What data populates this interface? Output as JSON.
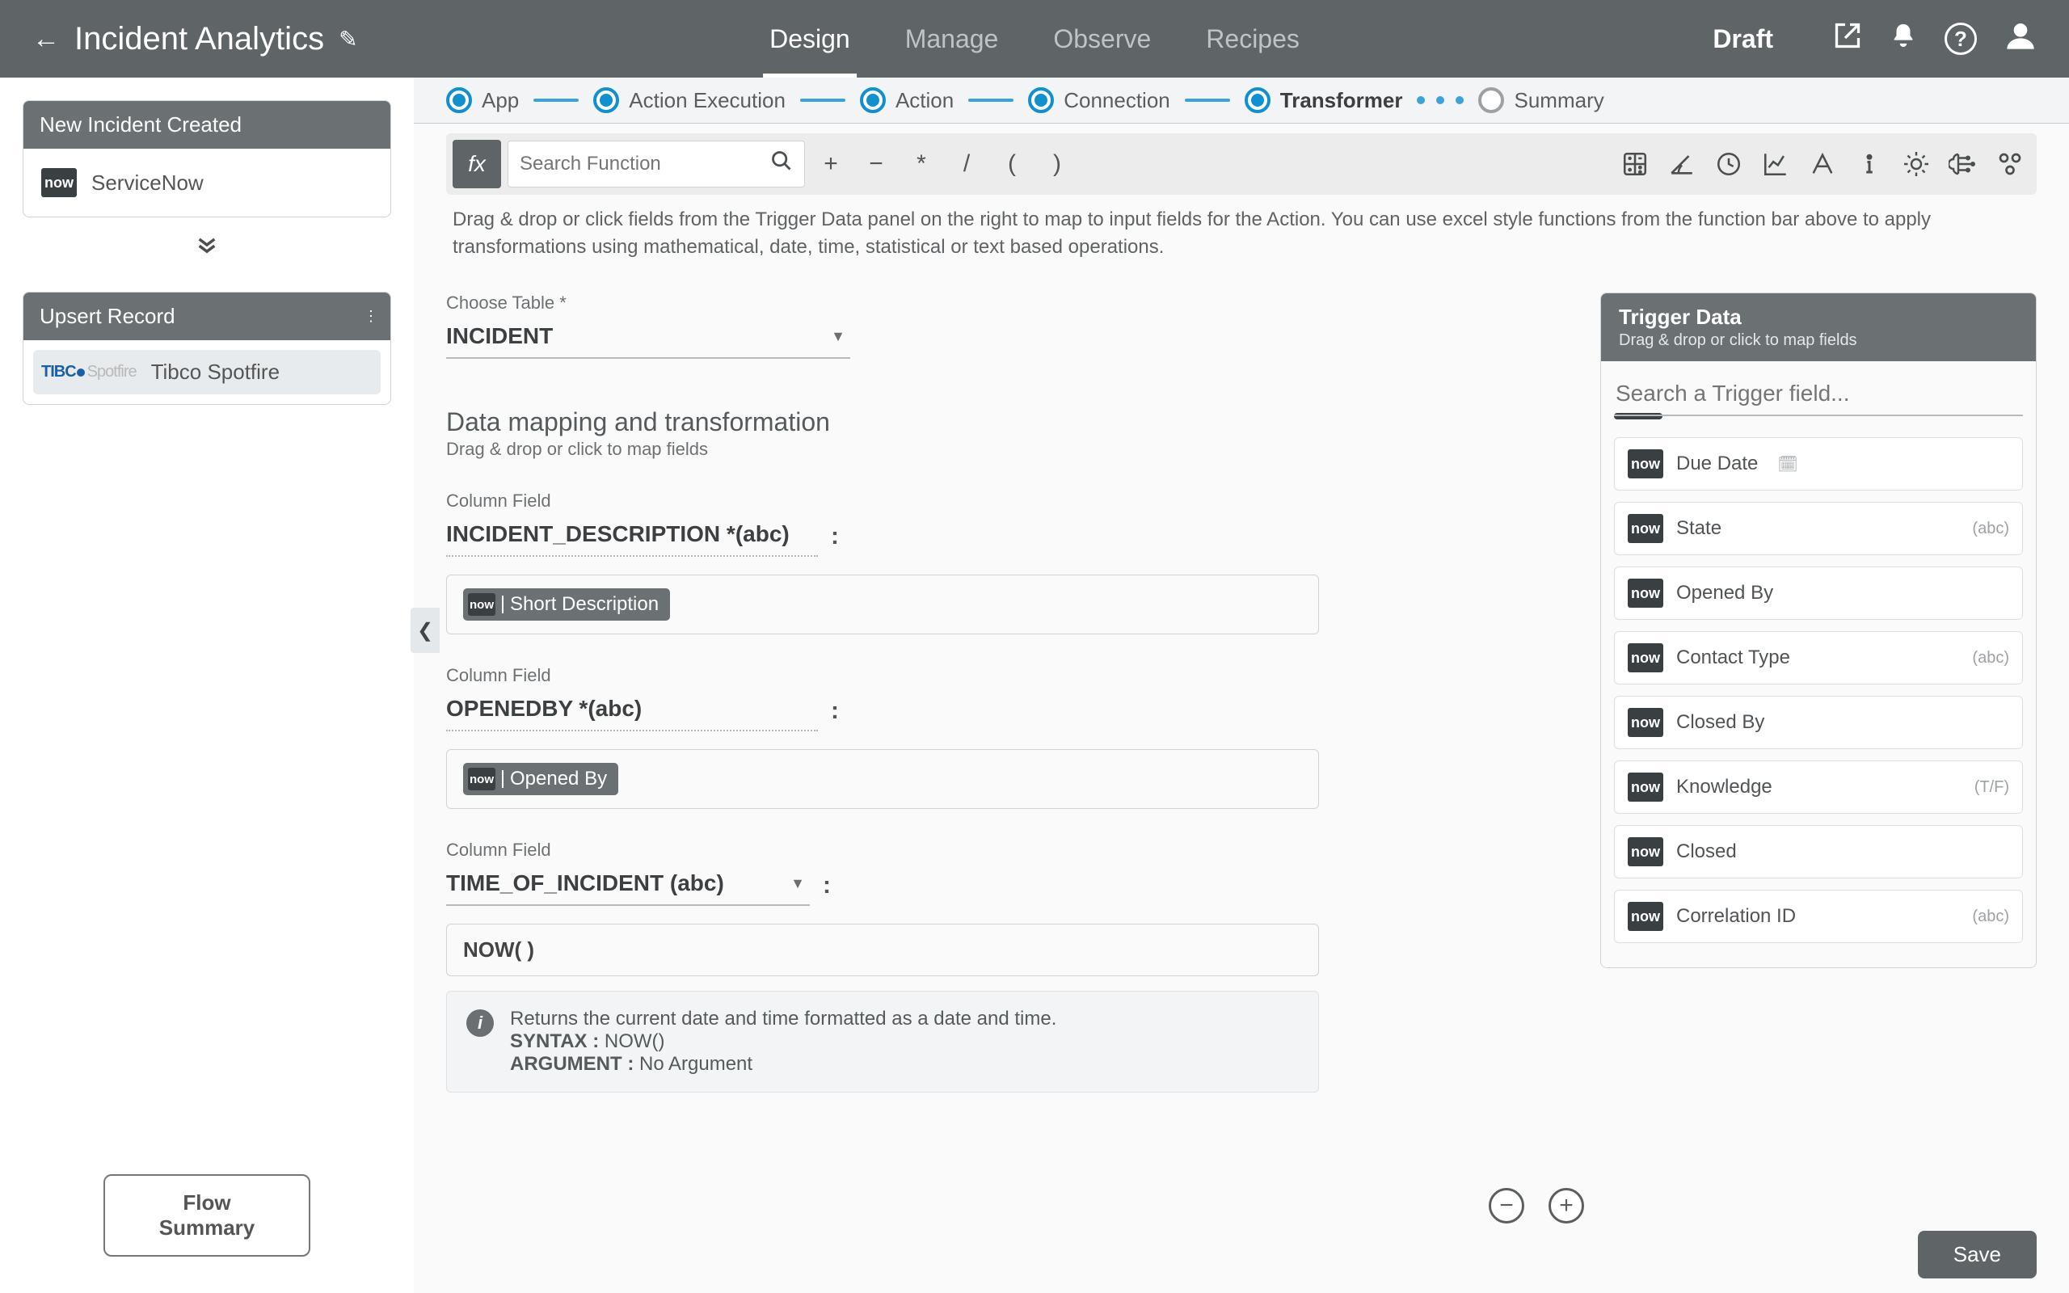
{
  "status": "Draft",
  "app_title": "Incident Analytics",
  "top_tabs": {
    "design": "Design",
    "manage": "Manage",
    "observe": "Observe",
    "recipes": "Recipes"
  },
  "sidebar": {
    "trigger_card": {
      "title": "New Incident Created",
      "app": "ServiceNow"
    },
    "action_card": {
      "title": "Upsert Record",
      "app": "Tibco Spotfire"
    },
    "flow_summary": "Flow Summary"
  },
  "rail": {
    "app": "App",
    "exec": "Action Execution",
    "action": "Action",
    "connection": "Connection",
    "transformer": "Transformer",
    "summary": "Summary"
  },
  "func": {
    "fx": "fx",
    "search_placeholder": "Search Function",
    "ops": {
      "plus": "+",
      "minus": "−",
      "mul": "*",
      "div": "/",
      "lparen": "(",
      "rparen": ")"
    }
  },
  "hint": "Drag & drop or click fields from the Trigger Data panel on the right to map to input fields for the Action. You can use excel style functions from the function bar above to apply transformations using mathematical, date, time, statistical or text based operations.",
  "table": {
    "label": "Choose Table *",
    "value": "INCIDENT"
  },
  "mapping": {
    "title": "Data mapping and transformation",
    "sub": "Drag & drop or click to map fields",
    "col_label": "Column Field",
    "col1": {
      "field": "INCIDENT_DESCRIPTION *(abc)",
      "tag": "Short Description"
    },
    "col2": {
      "field": "OPENEDBY *(abc)",
      "tag": "Opened By"
    },
    "col3": {
      "field": "TIME_OF_INCIDENT (abc)",
      "expr": "NOW( )"
    },
    "help": {
      "line1": "Returns the current date and time formatted as a date and time.",
      "syntax_label": "SYNTAX :",
      "syntax_val": "NOW()",
      "arg_label": "ARGUMENT :",
      "arg_val": "No Argument"
    }
  },
  "trigger_panel": {
    "title": "Trigger Data",
    "sub": "Drag & drop or click to map fields",
    "search_placeholder": "Search a Trigger field...",
    "items": [
      {
        "label": "Due Date",
        "type": "",
        "icon": "cal"
      },
      {
        "label": "State",
        "type": "(abc)",
        "icon": ""
      },
      {
        "label": "Opened By",
        "type": "",
        "icon": ""
      },
      {
        "label": "Contact Type",
        "type": "(abc)",
        "icon": ""
      },
      {
        "label": "Closed By",
        "type": "",
        "icon": ""
      },
      {
        "label": "Knowledge",
        "type": "(T/F)",
        "icon": ""
      },
      {
        "label": "Closed",
        "type": "",
        "icon": ""
      },
      {
        "label": "Correlation ID",
        "type": "(abc)",
        "icon": ""
      }
    ]
  },
  "save": "Save"
}
